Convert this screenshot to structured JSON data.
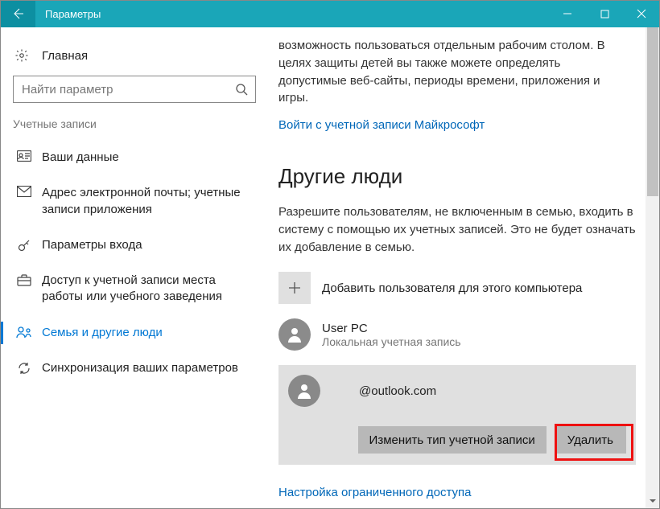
{
  "titlebar": {
    "title": "Параметры"
  },
  "sidebar": {
    "home_label": "Главная",
    "search_placeholder": "Найти параметр",
    "section_head": "Учетные записи",
    "items": [
      {
        "label": "Ваши данные"
      },
      {
        "label": "Адрес электронной почты; учетные записи приложения"
      },
      {
        "label": "Параметры входа"
      },
      {
        "label": "Доступ к учетной записи места работы или учебного заведения"
      },
      {
        "label": "Семья и другие люди"
      },
      {
        "label": "Синхронизация ваших параметров"
      }
    ]
  },
  "main": {
    "intro": "возможность пользоваться отдельным рабочим столом. В целях защиты детей вы также можете определять допустимые веб-сайты, периоды времени, приложения и игры.",
    "signin_link": "Войти с учетной записи Майкрософт",
    "other_people_heading": "Другие люди",
    "other_people_desc": "Разрешите пользователям, не включенным в семью, входить в систему с помощью их учетных записей. Это не будет означать их добавление в семью.",
    "add_user_label": "Добавить пользователя для этого компьютера",
    "accounts": [
      {
        "name": "User PC",
        "sub": "Локальная учетная запись"
      },
      {
        "name": "@outlook.com",
        "sub": ""
      }
    ],
    "change_type_btn": "Изменить тип учетной записи",
    "delete_btn": "Удалить",
    "restricted_link": "Настройка ограниченного доступа"
  }
}
